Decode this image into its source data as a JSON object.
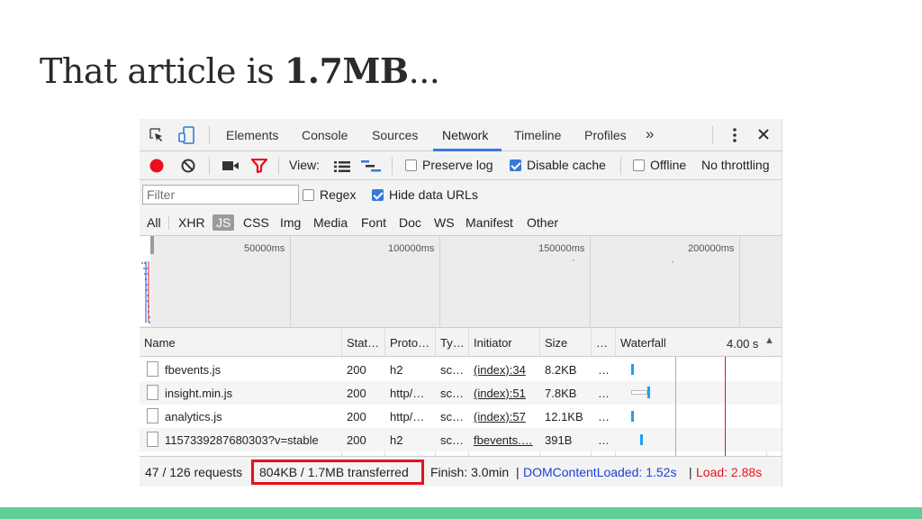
{
  "slide": {
    "title_prefix": "That article is ",
    "title_bold": "1.7MB",
    "title_suffix": "..."
  },
  "tabs": [
    {
      "label": "Elements"
    },
    {
      "label": "Console"
    },
    {
      "label": "Sources"
    },
    {
      "label": "Network",
      "active": true
    },
    {
      "label": "Timeline"
    },
    {
      "label": "Profiles"
    }
  ],
  "tabs_more": "»",
  "toolbar": {
    "view_label": "View:",
    "preserve_log": {
      "label": "Preserve log",
      "checked": false
    },
    "disable_cache": {
      "label": "Disable cache",
      "checked": true
    },
    "offline": {
      "label": "Offline",
      "checked": false
    },
    "throttling": "No throttling"
  },
  "filter": {
    "placeholder": "Filter",
    "regex": {
      "label": "Regex",
      "checked": false
    },
    "hide_data_urls": {
      "label": "Hide data URLs",
      "checked": true
    }
  },
  "types": [
    "All",
    "XHR",
    "JS",
    "CSS",
    "Img",
    "Media",
    "Font",
    "Doc",
    "WS",
    "Manifest",
    "Other"
  ],
  "active_type": "JS",
  "overview_ticks": [
    "50000ms",
    "100000ms",
    "150000ms",
    "200000ms"
  ],
  "columns": {
    "name": "Name",
    "status": "Stat…",
    "protocol": "Proto…",
    "type": "Ty…",
    "initiator": "Initiator",
    "size": "Size",
    "time": "…",
    "waterfall": "Waterfall",
    "waterfall_time": "4.00 s",
    "sort_icon": "▲"
  },
  "rows": [
    {
      "name": "fbevents.js",
      "status": "200",
      "protocol": "h2",
      "type": "sc…",
      "initiator": "(index):34",
      "size": "8.2KB",
      "time": "…"
    },
    {
      "name": "insight.min.js",
      "status": "200",
      "protocol": "http/…",
      "type": "sc…",
      "initiator": "(index):51",
      "size": "7.8KB",
      "time": "…"
    },
    {
      "name": "analytics.js",
      "status": "200",
      "protocol": "http/…",
      "type": "sc…",
      "initiator": "(index):57",
      "size": "12.1KB",
      "time": "…"
    },
    {
      "name": "1157339287680303?v=stable",
      "status": "200",
      "protocol": "h2",
      "type": "sc…",
      "initiator": "fbevents.…",
      "size": "391B",
      "time": "…"
    }
  ],
  "status": {
    "requests": "47 / 126 requests",
    "transferred": "804KB / 1.7MB transferred",
    "finish": "Finish: 3.0min",
    "divider": "|",
    "domcontentloaded": "DOMContentLoaded: 1.52s",
    "load": "Load: 2.88s"
  },
  "colors": {
    "accent": "#3879d9",
    "load_red": "#e8101c",
    "dcl_blue": "#1a3fd8",
    "record_red": "#e8101c",
    "footer_green": "#5fcf97"
  }
}
